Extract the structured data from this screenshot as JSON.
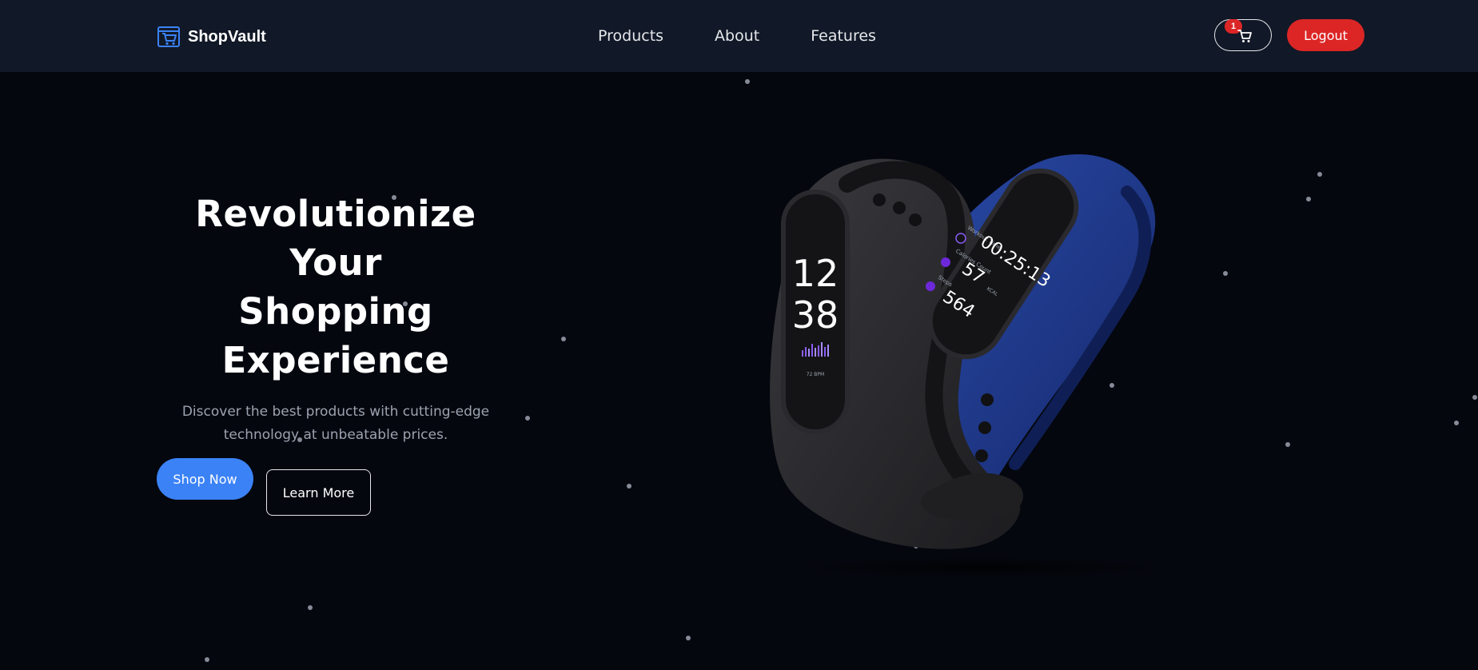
{
  "brand": {
    "name": "ShopVault",
    "icon": "shopping-cart-icon",
    "accent_color": "#3b82f6"
  },
  "nav": {
    "links": [
      "Products",
      "About",
      "Features"
    ]
  },
  "cart": {
    "icon": "cart-icon",
    "count": "1",
    "badge_color": "#dc2626"
  },
  "logout": {
    "label": "Logout",
    "color": "#dc2626"
  },
  "hero": {
    "title_lines": [
      "Revolutionize",
      "Your",
      "Shopping",
      "Experience"
    ],
    "subtitle_line1": "Discover the best products with cutting-edge",
    "subtitle_line2": "technology at unbeatable prices.",
    "shop_now_label": "Shop Now",
    "learn_more_label": "Learn More",
    "primary_color": "#3b82f6"
  },
  "product_image": {
    "description_icon": "fitness-band-image",
    "left_band_screen": {
      "hour": "12",
      "minute": "38",
      "bpm": "72 BPM"
    },
    "right_band_screen": {
      "workout_label": "Workout Time",
      "workout_value": "00:25:13",
      "calories_label": "Calories Count",
      "calories_value": "57",
      "calories_unit": "KCAL",
      "steps_label": "Steps",
      "steps_value": "564"
    },
    "band_colors": {
      "left": "#2a2a2c",
      "right": "#1e3a8a"
    }
  },
  "theme": {
    "background": "#05070f",
    "header_background": "#111827",
    "particle_color": "#9ca3af"
  }
}
